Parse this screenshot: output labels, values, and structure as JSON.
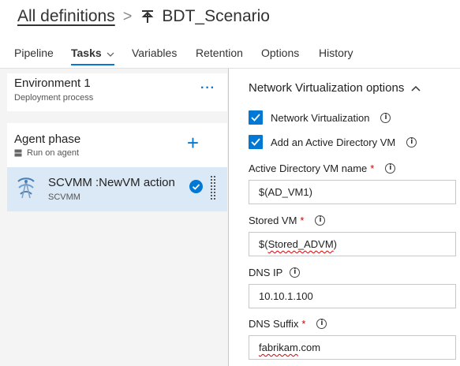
{
  "header": {
    "breadcrumb_link": "All definitions",
    "pipeline_name": "BDT_Scenario"
  },
  "tabs": [
    {
      "label": "Pipeline"
    },
    {
      "label": "Tasks"
    },
    {
      "label": "Variables"
    },
    {
      "label": "Retention"
    },
    {
      "label": "Options"
    },
    {
      "label": "History"
    }
  ],
  "left": {
    "environment": {
      "title": "Environment 1",
      "subtitle": "Deployment process",
      "more": "···"
    },
    "agent_phase": {
      "title": "Agent phase",
      "subtitle": "Run on agent",
      "add": "+"
    },
    "task": {
      "title": "SCVMM :NewVM action",
      "subtitle": "SCVMM"
    }
  },
  "right": {
    "section_title": "Network Virtualization options",
    "checkboxes": [
      {
        "label": "Network Virtualization",
        "checked": true
      },
      {
        "label": "Add an Active Directory VM",
        "checked": true
      }
    ],
    "fields": [
      {
        "label": "Active Directory VM name",
        "required": "*",
        "value": "$(AD_VM1)"
      },
      {
        "label": "Stored VM",
        "required": "*",
        "value_prefix": "$(",
        "value_squiggle": "Stored_ADVM",
        "value_suffix": ")"
      },
      {
        "label": "DNS IP",
        "required": "",
        "value": "10.10.1.100"
      },
      {
        "label": "DNS Suffix",
        "required": "*",
        "value_squiggle": "fabrikam",
        "value_suffix": ".com"
      }
    ]
  },
  "colors": {
    "accent": "#0078d4",
    "selected_row": "#dbe8f6",
    "left_bg": "#f4f4f4",
    "required": "#cc0000"
  }
}
